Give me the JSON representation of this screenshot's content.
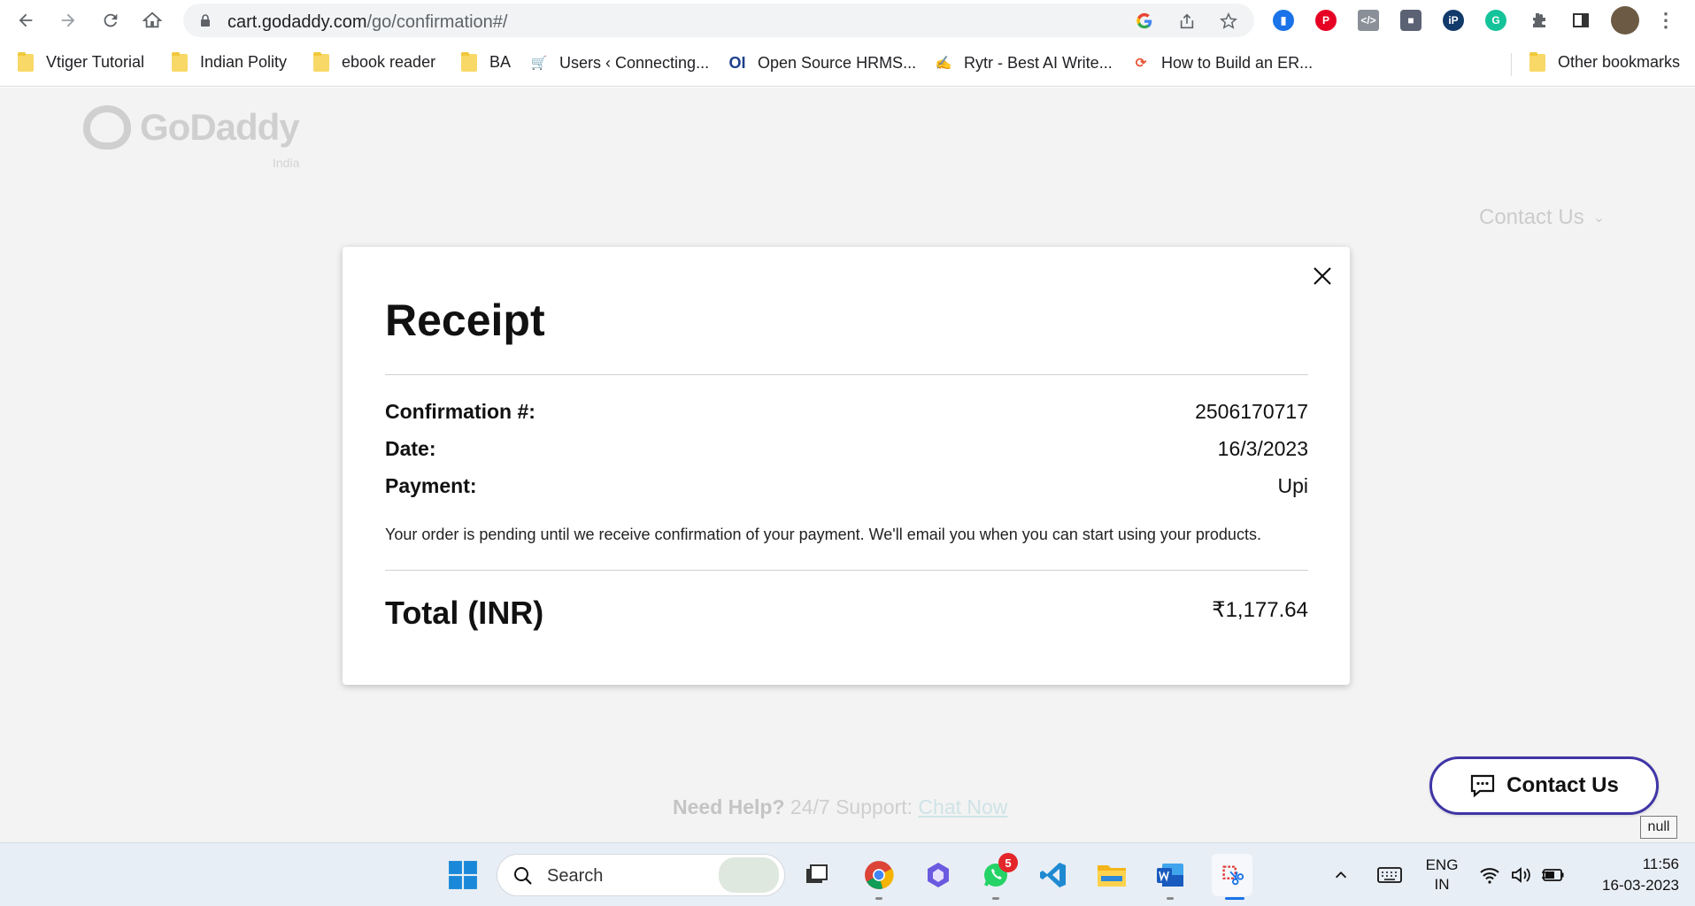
{
  "browser": {
    "url_host": "cart.godaddy.com",
    "url_path": "/go/confirmation#/",
    "bookmarks": [
      {
        "label": "Vtiger Tutorial"
      },
      {
        "label": "Indian Polity"
      },
      {
        "label": "ebook reader"
      },
      {
        "label": "BA"
      },
      {
        "label": "Users ‹ Connecting..."
      },
      {
        "label": "Open Source HRMS..."
      },
      {
        "label": "Rytr - Best AI Write..."
      },
      {
        "label": "How to Build an ER..."
      }
    ],
    "other_bookmarks": "Other bookmarks"
  },
  "header": {
    "brand_name": "GoDaddy",
    "brand_region": "India",
    "contact_label": "Contact Us"
  },
  "receipt": {
    "title": "Receipt",
    "confirmation_label": "Confirmation #:",
    "confirmation_value": "2506170717",
    "date_label": "Date:",
    "date_value": "16/3/2023",
    "payment_label": "Payment:",
    "payment_value": "Upi",
    "note": "Your order is pending until we receive confirmation of your payment. We'll email you when you can start using your products.",
    "total_label": "Total (INR)",
    "total_value": "₹1,177.64"
  },
  "help": {
    "prefix": "Need Help?",
    "support": " 24/7 Support: ",
    "chat": "Chat Now"
  },
  "floating_contact": {
    "label": "Contact Us"
  },
  "tooltip": "null",
  "taskbar": {
    "search_label": "Search",
    "whatsapp_badge": "5",
    "lang_line1": "ENG",
    "lang_line2": "IN",
    "time": "11:56",
    "date": "16-03-2023"
  },
  "colors": {
    "contact_border": "#3f35a6",
    "page_background": "#f3f3f3",
    "chat_link": "#cfe3e6"
  }
}
